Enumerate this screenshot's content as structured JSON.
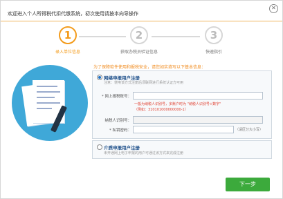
{
  "window": {
    "title": "欢迎进入个人所得税代扣代缴系统，初次使用请按本向导操作",
    "close_glyph": "✕"
  },
  "steps": [
    {
      "number": "1",
      "label": "录入单位信息",
      "state": "active"
    },
    {
      "number": "2",
      "label": "获取办税员验证信息",
      "state": "idle"
    },
    {
      "number": "3",
      "label": "快速指引",
      "state": "idle"
    }
  ],
  "notice": "为了保障软件使用和报税安全，请您如实填写以下基本信息：",
  "online_option": {
    "title": "网络申报用户注册",
    "note": "注意：使用该方式注册后须联网进行系统认证方可用",
    "selected": true,
    "fields": {
      "reg_no_label": "* 网上报税账号：",
      "reg_no_value": "",
      "hint_line1": "一般为纳税人识别号，多账户时为 \"纳税人识别号+数字\"",
      "hint_line2": "（例如：310101000000000-1）",
      "taxpayer_id_label": "纳税人识别号：",
      "taxpayer_id_value": "",
      "password_label": "* 私钥密码：",
      "password_value": "",
      "password_suffix": "（请区分大小写）"
    }
  },
  "offline_option": {
    "title": "介质申报用户注册",
    "note": "未开通网上电子申报的用户可通过该方式来完成注册",
    "selected": false
  },
  "next_button": "下一步",
  "colors": {
    "accent_orange": "#f39b1b",
    "illustration_blue": "#3fa8d8",
    "next_green": "#3caa3c",
    "hint_red": "#e03c2c"
  }
}
